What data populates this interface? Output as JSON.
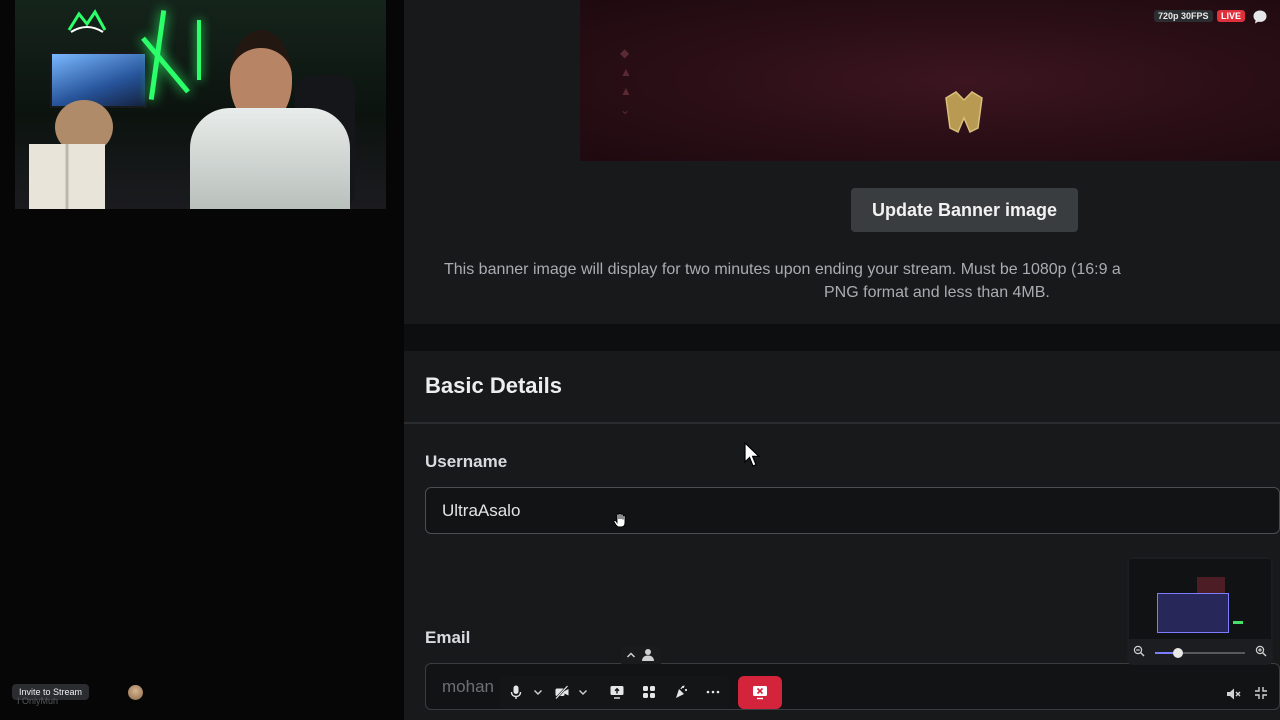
{
  "stream": {
    "quality_label": "720p 30FPS",
    "live_label": "LIVE",
    "invite_label": "Invite to Stream",
    "viewer_name": "I OnlyMuh"
  },
  "settings": {
    "banner_button_label": "Update Banner image",
    "banner_note_line1": "This banner image will display for two minutes upon ending your stream. Must be 1080p (16:9 a",
    "banner_note_line2": "PNG format and less than 4MB.",
    "basic_details_title": "Basic Details",
    "username_label": "Username",
    "username_value": "UltraAsalo",
    "email_label": "Email",
    "email_value": "mohan"
  },
  "mini_preview": {
    "zoom_level": 0.25
  },
  "icons": {
    "microphone": "microphone-icon",
    "camera_off": "camera-off-icon",
    "screen_share": "screen-share-icon",
    "apps": "apps-icon",
    "effects": "effects-icon",
    "more": "more-icon",
    "end_stream": "end-stream-icon",
    "chat": "chat-icon",
    "mute": "mute-icon",
    "collapse": "collapse-icon"
  },
  "colors": {
    "live": "#e0303c",
    "end_stream": "#d3243c",
    "accent": "#7c7cff"
  }
}
